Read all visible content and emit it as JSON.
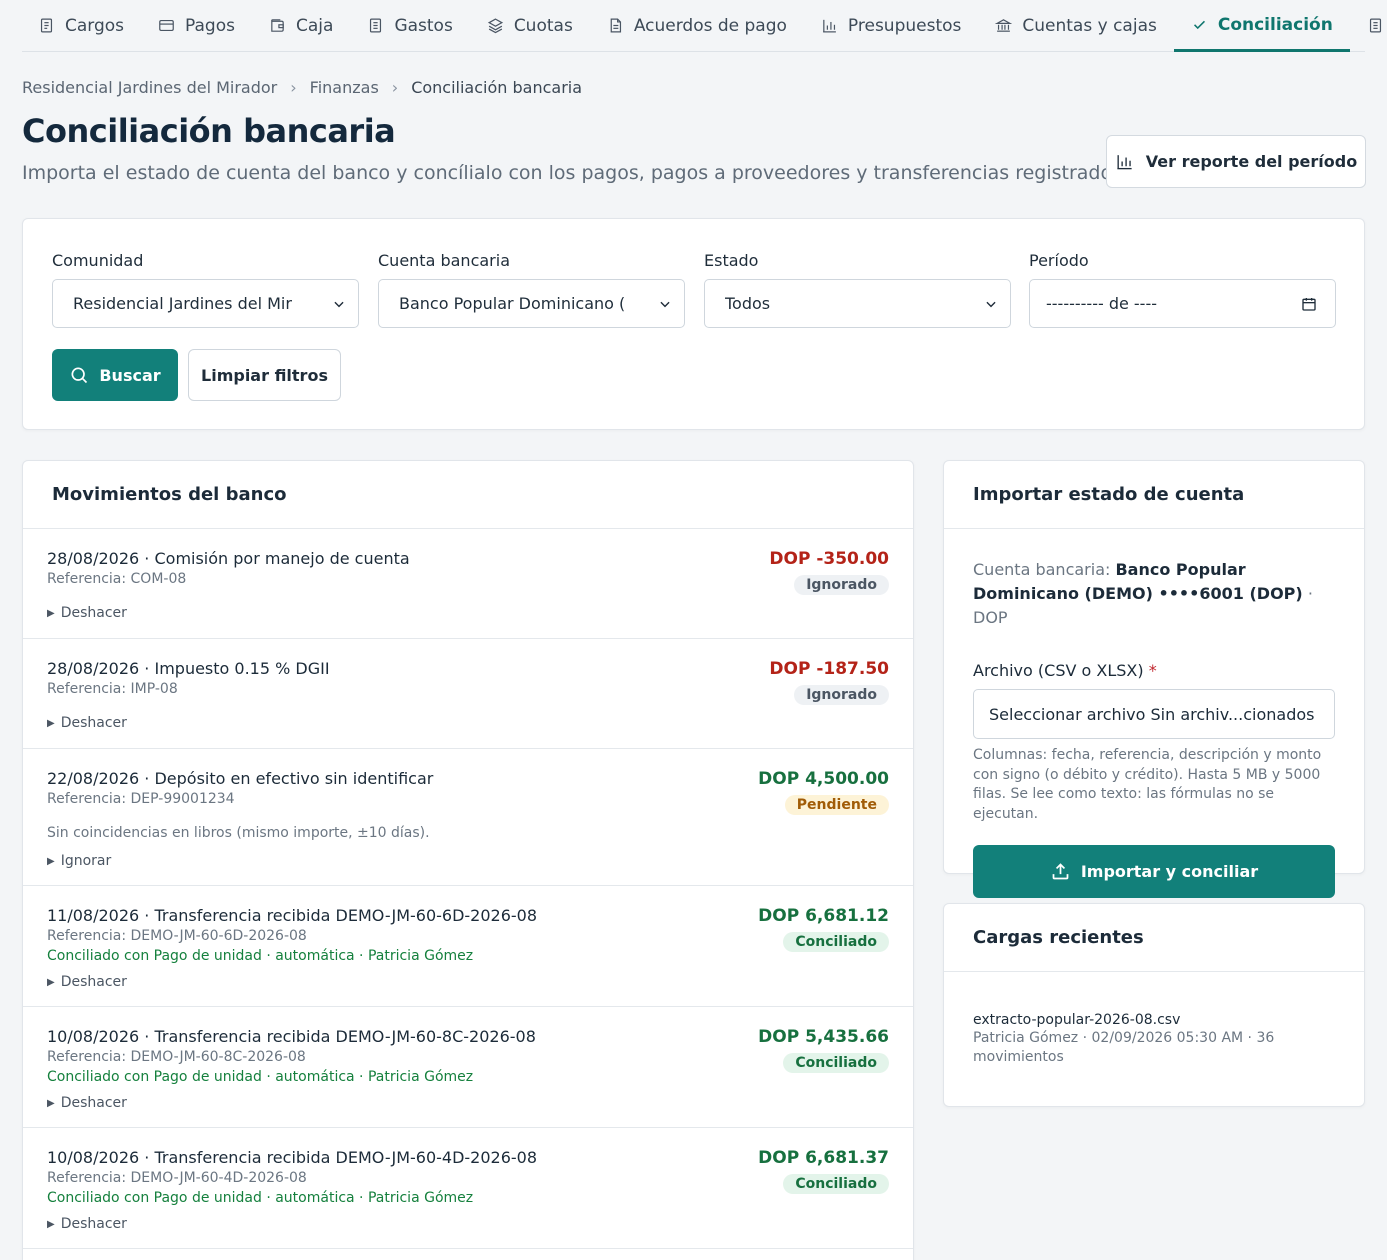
{
  "nav": [
    {
      "label": "Cargos",
      "icon": "doc-icon",
      "active": false
    },
    {
      "label": "Pagos",
      "icon": "card-icon",
      "active": false
    },
    {
      "label": "Caja",
      "icon": "wallet-icon",
      "active": false
    },
    {
      "label": "Gastos",
      "icon": "receipt-icon",
      "active": false
    },
    {
      "label": "Cuotas",
      "icon": "layers-icon",
      "active": false
    },
    {
      "label": "Acuerdos de pago",
      "icon": "file-icon",
      "active": false
    },
    {
      "label": "Presupuestos",
      "icon": "bar-chart-icon",
      "active": false
    },
    {
      "label": "Cuentas y cajas",
      "icon": "bank-icon",
      "active": false
    },
    {
      "label": "Conciliación",
      "icon": "check-icon",
      "active": true
    }
  ],
  "breadcrumb": [
    "Residencial Jardines del Mirador",
    "Finanzas",
    "Conciliación bancaria"
  ],
  "page": {
    "title": "Conciliación bancaria",
    "subtitle": "Importa el estado de cuenta del banco y concílialo con los pagos, pagos a proveedores y transferencias registrados.",
    "report_button": "Ver reporte del período"
  },
  "filters": {
    "community_label": "Comunidad",
    "community_value": "Residencial Jardines del Mir",
    "account_label": "Cuenta bancaria",
    "account_value": "Banco Popular Dominicano (",
    "status_label": "Estado",
    "status_value": "Todos",
    "period_label": "Período",
    "period_value": "---------- de ----",
    "search_button": "Buscar",
    "clear_button": "Limpiar filtros"
  },
  "movements": {
    "title": "Movimientos del banco",
    "items": [
      {
        "title": "28/08/2026 · Comisión por manejo de cuenta",
        "ref": "Referencia: COM-08",
        "amount": "DOP -350.00",
        "sign": "neg",
        "status": "Ignorado",
        "status_kind": "ign",
        "note": "",
        "match": "",
        "action": "Deshacer"
      },
      {
        "title": "28/08/2026 · Impuesto 0.15 % DGII",
        "ref": "Referencia: IMP-08",
        "amount": "DOP -187.50",
        "sign": "neg",
        "status": "Ignorado",
        "status_kind": "ign",
        "note": "",
        "match": "",
        "action": "Deshacer"
      },
      {
        "title": "22/08/2026 · Depósito en efectivo sin identificar",
        "ref": "Referencia: DEP-99001234",
        "amount": "DOP 4,500.00",
        "sign": "pos",
        "status": "Pendiente",
        "status_kind": "pen",
        "note": "Sin coincidencias en libros (mismo importe, ±10 días).",
        "match": "",
        "action": "Ignorar"
      },
      {
        "title": "11/08/2026 · Transferencia recibida DEMO-JM-60-6D-2026-08",
        "ref": "Referencia: DEMO-JM-60-6D-2026-08",
        "amount": "DOP 6,681.12",
        "sign": "pos",
        "status": "Conciliado",
        "status_kind": "con",
        "note": "",
        "match": "Conciliado con Pago de unidad · automática · Patricia Gómez",
        "action": "Deshacer"
      },
      {
        "title": "10/08/2026 · Transferencia recibida DEMO-JM-60-8C-2026-08",
        "ref": "Referencia: DEMO-JM-60-8C-2026-08",
        "amount": "DOP 5,435.66",
        "sign": "pos",
        "status": "Conciliado",
        "status_kind": "con",
        "note": "",
        "match": "Conciliado con Pago de unidad · automática · Patricia Gómez",
        "action": "Deshacer"
      },
      {
        "title": "10/08/2026 · Transferencia recibida DEMO-JM-60-4D-2026-08",
        "ref": "Referencia: DEMO-JM-60-4D-2026-08",
        "amount": "DOP 6,681.37",
        "sign": "pos",
        "status": "Conciliado",
        "status_kind": "con",
        "note": "",
        "match": "Conciliado con Pago de unidad · automática · Patricia Gómez",
        "action": "Deshacer"
      }
    ]
  },
  "import": {
    "title": "Importar estado de cuenta",
    "account_prefix": "Cuenta bancaria:",
    "account_name": "Banco Popular Dominicano (DEMO) ••••6001 (DOP)",
    "account_suffix": "· DOP",
    "file_label": "Archivo (CSV o XLSX)",
    "required_mark": "*",
    "file_value": "Seleccionar archivo Sin archiv...cionados",
    "help": "Columnas: fecha, referencia, descripción y monto con signo (o débito y crédito). Hasta 5 MB y 5000 filas. Se lee como texto: las fórmulas no se ejecutan.",
    "button": "Importar y conciliar"
  },
  "recent": {
    "title": "Cargas recientes",
    "file": "extracto-popular-2026-08.csv",
    "meta": "Patricia Gómez · 02/09/2026 05:30 AM · 36 movimientos"
  },
  "colors": {
    "accent": "#12807a",
    "negative": "#b42318",
    "positive": "#17703f"
  }
}
